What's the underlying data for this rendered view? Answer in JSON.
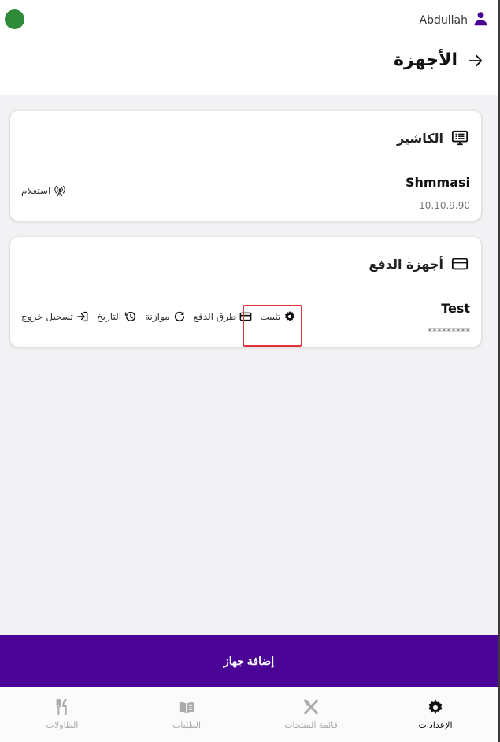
{
  "user": {
    "name": "Abdullah",
    "icon": "person-icon"
  },
  "header": {
    "title": "الأجهزة",
    "back_icon": "arrow-right-icon"
  },
  "cashier_card": {
    "title": "الكاشير",
    "icon": "monitor-list-icon",
    "device_name": "Shmmasi",
    "ip": "10.10.9.90",
    "action_label": "استعلام"
  },
  "payment_card": {
    "title": "أجهزة الدفع",
    "icon": "credit-card-icon",
    "device_name": "Test",
    "secret": "*********",
    "actions": {
      "install": "تثبيت",
      "payment_methods": "طرق الدفع",
      "balance": "موازنة",
      "history": "التاريخ",
      "logout": "تسجيل خروج"
    }
  },
  "add_button": "إضافة جهاز",
  "bottom_nav": [
    {
      "label": "الإعدادات",
      "icon": "gear-icon",
      "active": true
    },
    {
      "label": "قائمة المنتجات",
      "icon": "fork-knife-icon",
      "active": false
    },
    {
      "label": "الطلبات",
      "icon": "book-icon",
      "active": false
    },
    {
      "label": "الطاولات",
      "icon": "utensils-icon",
      "active": false
    }
  ],
  "colors": {
    "accent": "#4a0596",
    "status": "#2e8b3a",
    "highlight": "#e0343a"
  }
}
